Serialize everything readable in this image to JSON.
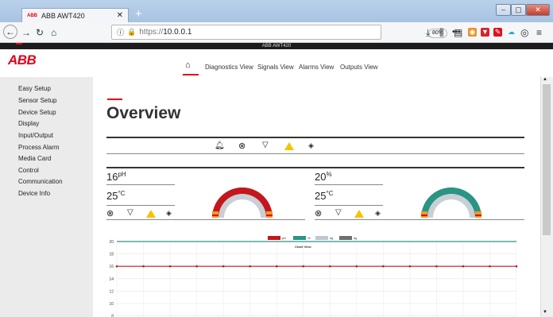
{
  "browser": {
    "tab_title": "ABB AWT420",
    "tab_logo": "ABB",
    "url_scheme": "https://",
    "url_host": "10.0.0.1",
    "zoom": "80%",
    "banner": "ABB AWT420"
  },
  "app": {
    "logo": "ABB",
    "nav": [
      "Diagnostics View",
      "Signals View",
      "Alarms View",
      "Outputs View"
    ],
    "sidebar": [
      "Easy Setup",
      "Sensor Setup",
      "Device Setup",
      "Display",
      "Input/Output",
      "Process Alarm",
      "Media Card",
      "Control",
      "Communication",
      "Device Info"
    ],
    "page_title": "Overview"
  },
  "channels": [
    {
      "value": "16",
      "unit": "pH",
      "temp": "25",
      "temp_unit": "°C",
      "gauge_color": "#c4161c",
      "gauge_fraction": 1.0
    },
    {
      "value": "20",
      "unit": "%",
      "temp": "25",
      "temp_unit": "°C",
      "gauge_color": "#2a9485",
      "gauge_fraction": 1.0
    }
  ],
  "chart_data": {
    "type": "line",
    "title": "Chart View",
    "legend": [
      {
        "name": "pH",
        "color": "#c4161c"
      },
      {
        "name": "%",
        "color": "#2a9485"
      },
      {
        "name": "kg",
        "color": "#bfc8d0"
      },
      {
        "name": "kg",
        "color": "#6e6e6e"
      }
    ],
    "yticks": [
      20,
      18,
      16,
      14,
      12,
      10,
      8
    ],
    "ylim": [
      8,
      20
    ],
    "series": [
      {
        "name": "pH",
        "color": "#c4161c",
        "values": [
          16,
          16,
          16,
          16,
          16,
          16,
          16,
          16,
          16,
          16,
          16,
          16,
          16,
          16,
          16,
          16
        ]
      },
      {
        "name": "%",
        "color": "#2a9485",
        "values": [
          20,
          20,
          20,
          20,
          20,
          20,
          20,
          20,
          20,
          20,
          20,
          20,
          20,
          20,
          20,
          20
        ]
      }
    ],
    "grid": true
  }
}
